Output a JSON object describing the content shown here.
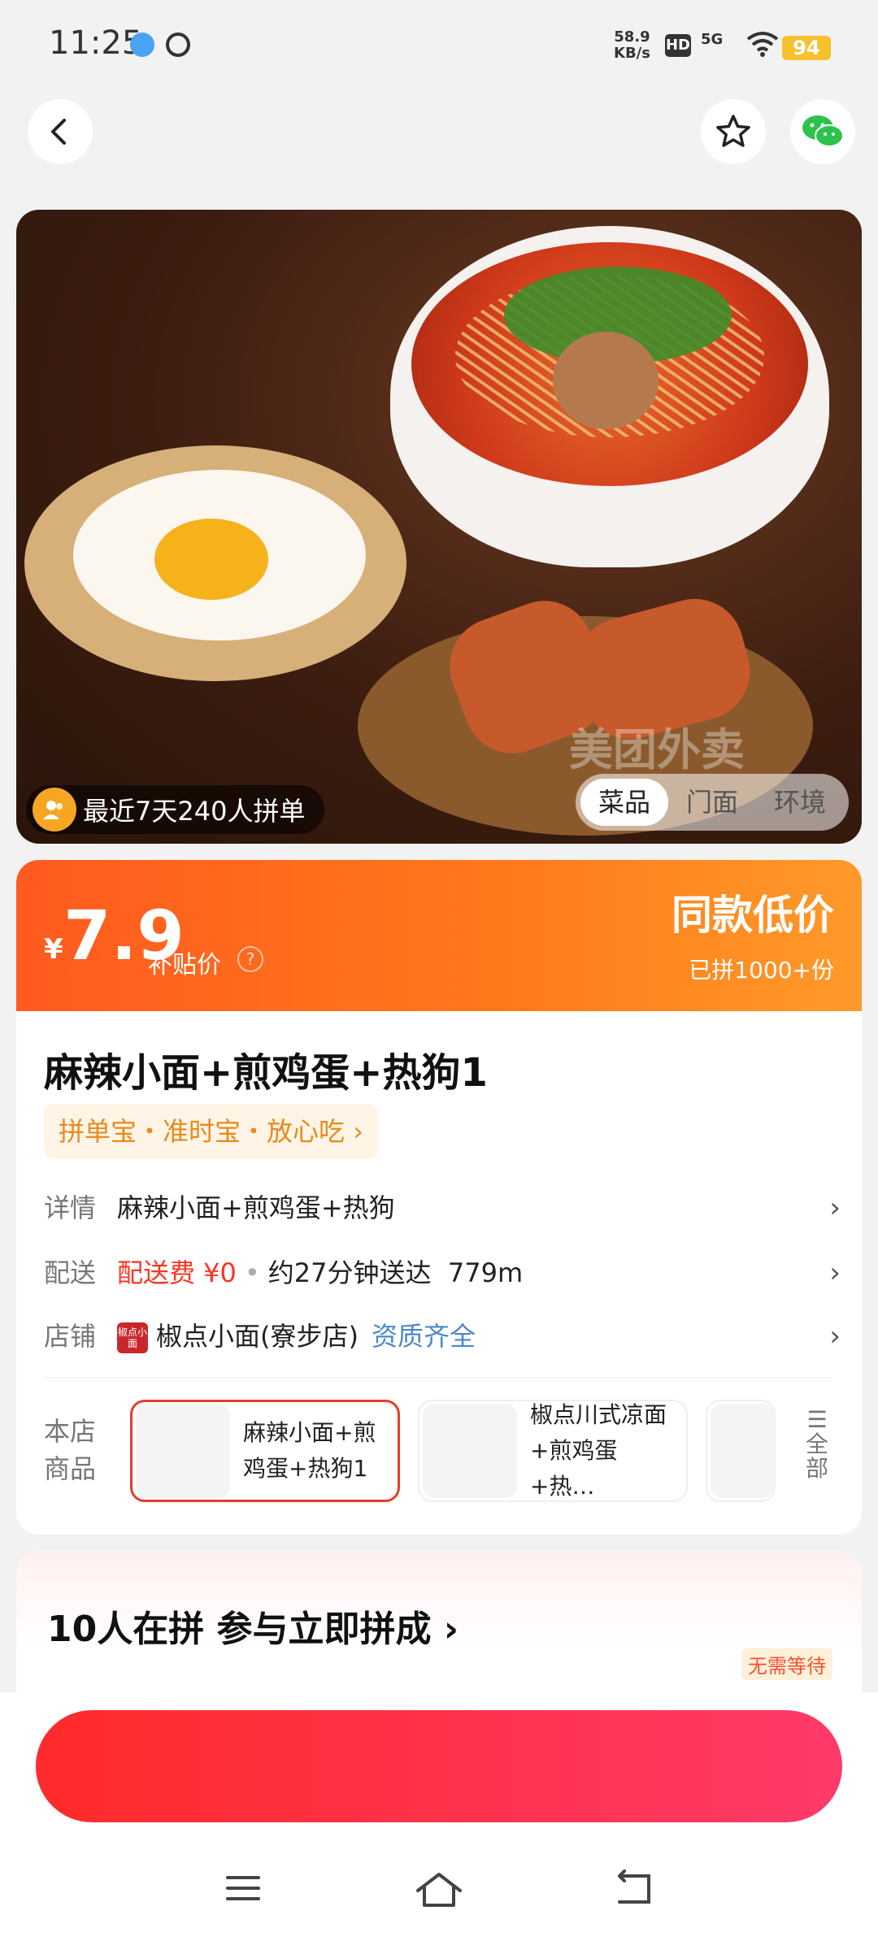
{
  "status_bar": {
    "time": "11:25",
    "net_speed_top": "58.9",
    "net_speed_unit": "KB/s",
    "hd": "HD",
    "signal": "5G",
    "battery": "94"
  },
  "nav": {
    "back_icon": "back-arrow-icon",
    "fav_icon": "star-icon",
    "share_icon": "wechat-icon"
  },
  "hero": {
    "watermark": "美团外卖",
    "people_text": "最近7天240人拼单",
    "tabs": [
      "菜品",
      "门面",
      "环境"
    ],
    "active_tab": "菜品"
  },
  "price": {
    "currency": "¥",
    "value": "7.9",
    "label": "补贴价",
    "badge": "同款低价",
    "sold": "已拼1000+份",
    "help": "?"
  },
  "product": {
    "title": "麻辣小面+煎鸡蛋+热狗1",
    "tags": "拼单宝・准时宝・放心吃",
    "detail_label": "详情",
    "detail_value": "麻辣小面+煎鸡蛋+热狗",
    "delivery_label": "配送",
    "delivery_fee": "配送费 ¥0",
    "delivery_time": "约27分钟送达",
    "delivery_dist": "779m",
    "shop_label": "店铺",
    "shop_logo_text": "椒点小面",
    "shop_name": "椒点小面(寮步店)",
    "shop_cert": "资质齐全"
  },
  "store_items": {
    "label": "本店商品",
    "items": [
      {
        "name": "麻辣小面+煎鸡蛋+热狗1"
      },
      {
        "name": "椒点川式凉面+煎鸡蛋+热…"
      }
    ],
    "all_label": "全部"
  },
  "group": {
    "title": "10人在拼 参与立即拼成",
    "no_wait": "无需等待"
  },
  "colors": {
    "accent": "#ff5a1f",
    "cta": "#ff2a3a"
  }
}
